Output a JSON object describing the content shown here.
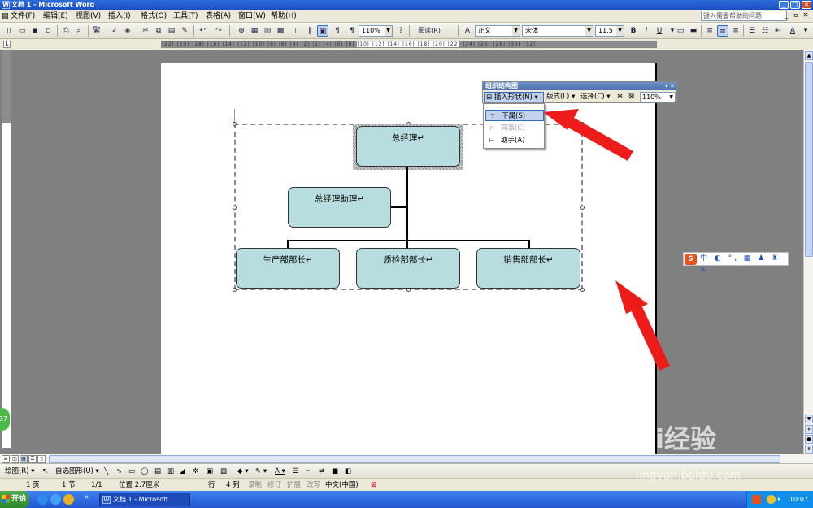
{
  "window": {
    "title": "文档 1 - Microsoft Word"
  },
  "menu": [
    "文件(F)",
    "编辑(E)",
    "视图(V)",
    "插入(I)",
    "格式(O)",
    "工具(T)",
    "表格(A)",
    "窗口(W)",
    "帮助(H)"
  ],
  "help_box": "键入需要帮助的问题",
  "toolbar": {
    "zoom": "110%",
    "read_label": "阅读(R)",
    "style": "正文",
    "font": "宋体",
    "size": "11.5",
    "bold": "B",
    "italic": "I",
    "underline": "U",
    "font_color": "A"
  },
  "ruler": {
    "text": "|22| |20| |18| |16| |14| |12| |10| |8| |6| |4| |2| |2| |4| |6| |8| |10| |12| |14| |16| |18| |20| |22| |24| |26| |28| |30| |32|"
  },
  "org_chart": {
    "top": "总经理",
    "assistant": "总经理助理",
    "subordinates": [
      "生产部部长",
      "质检部部长",
      "销售部部长"
    ]
  },
  "org_toolbar": {
    "title": "组织结构图",
    "insert_shape": "插入形状(N)",
    "layout": "版式(L)",
    "select": "选择(C)",
    "zoom": "110%"
  },
  "insert_menu": [
    {
      "label": "下属(S)",
      "state": "highlighted"
    },
    {
      "label": "同事(C)",
      "state": "disabled"
    },
    {
      "label": "助手(A)",
      "state": "normal"
    }
  ],
  "ime": {
    "label": "中"
  },
  "drawing_toolbar": {
    "draw": "绘图(R)",
    "autoshapes": "自选图形(U)"
  },
  "status": {
    "page": "1 页",
    "section": "1 节",
    "page_of": "1/1",
    "position": "位置 2.7厘米",
    "line": "行",
    "col": "4 列",
    "rec": "录制",
    "trk": "修订",
    "ext": "扩展",
    "ovr": "改写",
    "lang": "中文(中国)"
  },
  "taskbar": {
    "start": "开始",
    "task": "文档 1 - Microsoft ...",
    "clock": "10:07"
  },
  "badge": "37",
  "watermark": {
    "brand": "Bai经验",
    "url": "jingyan.baidu.com"
  }
}
